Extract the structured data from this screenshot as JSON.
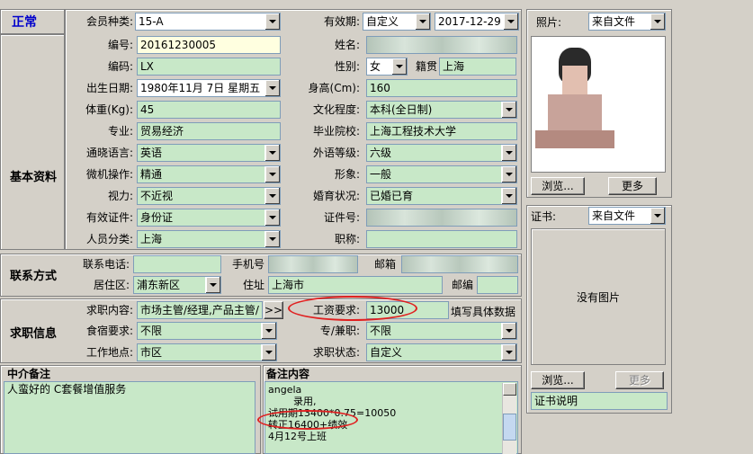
{
  "status": "正常",
  "section_labels": {
    "basic": "基本资料",
    "contact": "联系方式",
    "job": "求职信息",
    "agent_note": "中介备注",
    "remark": "备注内容"
  },
  "basic": {
    "member_type_label": "会员种类:",
    "member_type": "15-A",
    "validity_label": "有效期:",
    "validity_mode": "自定义",
    "validity_date": "2017-12-29",
    "id_label": "编号:",
    "id": "20161230005",
    "name_label": "姓名:",
    "code_label": "编码:",
    "code": "LX",
    "gender_label": "性别:",
    "gender": "女",
    "native_label": "籍贯",
    "native": "上海",
    "birth_label": "出生日期:",
    "birth": "1980年11月 7日 星期五",
    "height_label": "身高(Cm):",
    "height": "160",
    "weight_label": "体重(Kg):",
    "weight": "45",
    "edu_label": "文化程度:",
    "edu": "本科(全日制)",
    "major_label": "专业:",
    "major": "贸易经济",
    "school_label": "毕业院校:",
    "school": "上海工程技术大学",
    "lang_label": "通晓语言:",
    "lang": "英语",
    "foreign_label": "外语等级:",
    "foreign": "六级",
    "pc_label": "微机操作:",
    "pc": "精通",
    "look_label": "形象:",
    "look": "一般",
    "vision_label": "视力:",
    "vision": "不近视",
    "marital_label": "婚育状况:",
    "marital": "已婚已育",
    "cert_type_label": "有效证件:",
    "cert_type": "身份证",
    "cert_no_label": "证件号:",
    "category_label": "人员分类:",
    "category": "上海",
    "title_label": "职称:"
  },
  "contact": {
    "phone_label": "联系电话:",
    "mobile_label": "手机号",
    "email_label": "邮箱",
    "district_label": "居住区:",
    "district": "浦东新区",
    "address_label": "住址",
    "address": "上海市",
    "zip_label": "邮编"
  },
  "job": {
    "target_label": "求职内容:",
    "target": "市场主管/经理,产品主管/",
    "more_button": ">>",
    "salary_label": "工资要求:",
    "salary": "13000",
    "salary_hint": "填写具体数据",
    "board_label": "食宿要求:",
    "board": "不限",
    "parttime_label": "专/兼职:",
    "parttime": "不限",
    "location_label": "工作地点:",
    "location": "市区",
    "state_label": "求职状态:",
    "state": "自定义"
  },
  "agent_note": "人蛮好的 C套餐增值服务",
  "remark_lines": [
    "angela",
    "        录用,",
    "试用期13400*0.75=10050",
    "转正16400+绩效",
    "4月12号上班"
  ],
  "photo": {
    "label": "照片:",
    "source": "来自文件",
    "browse": "浏览...",
    "more": "更多"
  },
  "cert": {
    "label": "证书:",
    "source": "来自文件",
    "no_image": "没有图片",
    "browse": "浏览...",
    "more": "更多",
    "desc": "证书说明"
  }
}
